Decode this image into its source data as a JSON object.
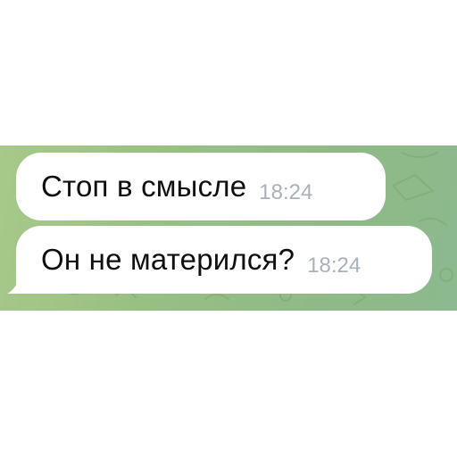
{
  "chat": {
    "messages": [
      {
        "text": "Стоп в смысле",
        "time": "18:24"
      },
      {
        "text": "Он не матерился?",
        "time": "18:24"
      }
    ]
  },
  "colors": {
    "chat_background": "#97c083",
    "bubble": "#ffffff",
    "text": "#0f0f0f",
    "timestamp": "#a9b1b9"
  }
}
